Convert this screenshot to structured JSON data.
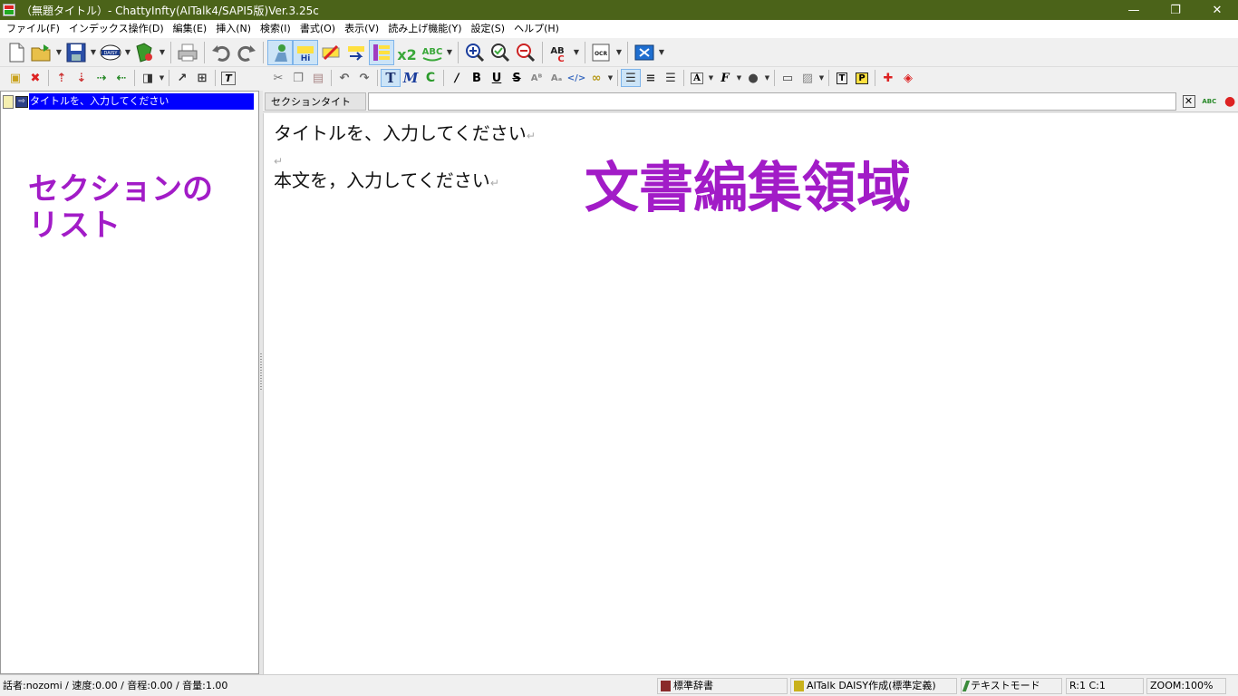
{
  "window": {
    "title": "（無題タイトル）- ChattyInfty(AITalk4/SAPI5版)Ver.3.25c",
    "minimize": "—",
    "restore": "❐",
    "close": "✕"
  },
  "menu": [
    "ファイル(F)",
    "インデックス操作(D)",
    "編集(E)",
    "挿入(N)",
    "検索(I)",
    "書式(O)",
    "表示(V)",
    "読み上げ機能(Y)",
    "設定(S)",
    "ヘルプ(H)"
  ],
  "toolbar_main": {
    "buttons": [
      {
        "name": "new-document",
        "icon": "new-document-icon"
      },
      {
        "name": "open",
        "icon": "open-folder-icon"
      },
      {
        "name": "save",
        "icon": "save-disk-icon"
      },
      {
        "name": "daisy",
        "icon": "daisy-icon",
        "label": "DAISY"
      },
      {
        "name": "export",
        "icon": "export-icon"
      },
      {
        "name": "print",
        "icon": "printer-icon"
      },
      {
        "name": "undo",
        "icon": "undo-icon"
      },
      {
        "name": "redo",
        "icon": "redo-icon"
      },
      {
        "name": "speak",
        "icon": "speak-icon"
      },
      {
        "name": "highlight",
        "icon": "highlight-icon",
        "label": "Hi"
      },
      {
        "name": "marker",
        "icon": "marker-icon"
      },
      {
        "name": "next-line",
        "icon": "next-line-icon"
      },
      {
        "name": "list",
        "icon": "list-icon"
      },
      {
        "name": "speed",
        "icon": "speed-icon",
        "label": "x2"
      },
      {
        "name": "spell",
        "icon": "spell-check-icon",
        "label": "ABC"
      },
      {
        "name": "zoom-in",
        "icon": "zoom-in-icon"
      },
      {
        "name": "zoom-fit",
        "icon": "zoom-fit-icon"
      },
      {
        "name": "zoom-out",
        "icon": "zoom-out-icon"
      },
      {
        "name": "spell-color",
        "icon": "abc-color-icon",
        "label": "AB"
      },
      {
        "name": "ocr",
        "icon": "ocr-icon",
        "label": "OCR"
      },
      {
        "name": "window",
        "icon": "window-icon"
      }
    ]
  },
  "left_panel": {
    "tree_item": "タイトルを、入力してください",
    "annotation": "セクションの\nリスト"
  },
  "section_bar": {
    "tab_label": "セクションタイトル",
    "input_value": ""
  },
  "editor": {
    "lines": [
      "タイトルを、入力してください",
      "",
      "本文を，入力してください"
    ],
    "annotation": "文書編集領域"
  },
  "status": {
    "speaker": "話者:nozomi / 速度:0.00 / 音程:0.00 / 音量:1.00",
    "dictionary": "標準辞書",
    "daisy_mode": "AITalk DAISY作成(標準定義)",
    "text_mode": "テキストモード",
    "position": "R:1 C:1",
    "zoom": "ZOOM:100%"
  },
  "colors": {
    "titlebar": "#4b6319",
    "annotation": "#a21cc7",
    "selection": "#0000ff"
  }
}
